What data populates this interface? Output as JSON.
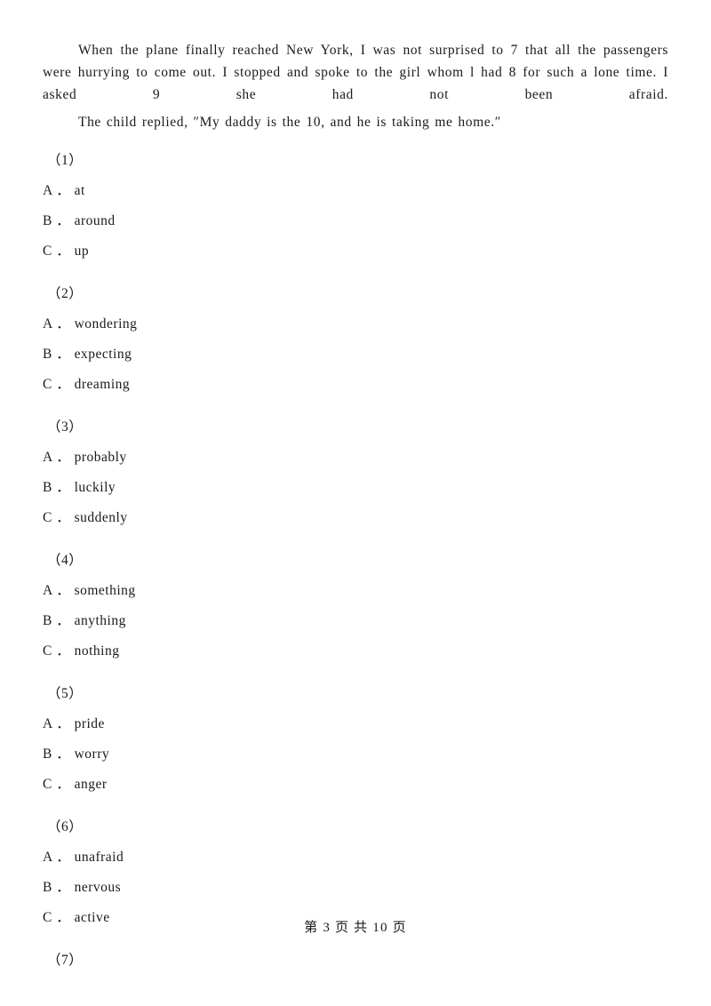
{
  "document": {
    "paragraphs": [
      "When the plane finally reached New York, I was not surprised to 7 that all the passengers were hurrying to come out. I stopped and spoke to the girl whom l had 8 for such a lone time.   I asked 9 she had not been afraid.",
      "The child replied, ″My daddy is the 10, and he is taking me home.″"
    ],
    "questions": [
      {
        "number": "（1）",
        "options": [
          "A ． at",
          "B ． around",
          "C ． up"
        ]
      },
      {
        "number": "（2）",
        "options": [
          "A ． wondering",
          "B ． expecting",
          "C ． dreaming"
        ]
      },
      {
        "number": "（3）",
        "options": [
          "A ． probably",
          "B ． luckily",
          "C ． suddenly"
        ]
      },
      {
        "number": "（4）",
        "options": [
          "A ． something",
          "B ． anything",
          "C ． nothing"
        ]
      },
      {
        "number": "（5）",
        "options": [
          "A ． pride",
          "B ． worry",
          "C ． anger"
        ]
      },
      {
        "number": "（6）",
        "options": [
          "A ． unafraid",
          "B ． nervous",
          "C ． active"
        ]
      },
      {
        "number": "（7）",
        "options": []
      }
    ],
    "footer": {
      "text": "第 3 页 共 10 页"
    }
  }
}
